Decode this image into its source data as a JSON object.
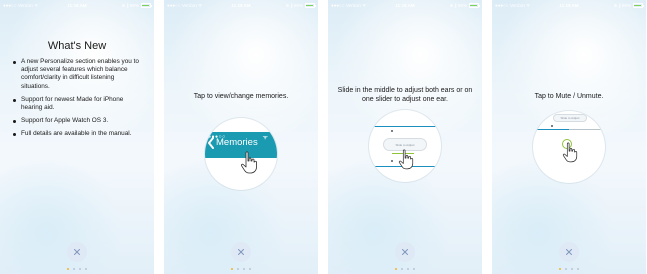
{
  "status_bar": {
    "carrier": "●●●○○ Verizon ᯤ",
    "time": "11:18 AM",
    "right_text": "⊕ ∦ 80%"
  },
  "screens": [
    {
      "title": "What's New",
      "bullets": [
        "A new Personalize section enables you to adjust several features which balance comfort/clarity in difficult listening situations.",
        "Support for newest Made for iPhone hearing aid.",
        "Support for Apple Watch OS 3.",
        "Full details are available in the manual."
      ]
    },
    {
      "instruction": "Tap to view/change memories.",
      "graphic": {
        "status_dots": "●●●○○",
        "wifi": "ᯤ",
        "back_label": "Memories"
      }
    },
    {
      "instruction": "Slide in the middle to adjust both ears or on one slider to adjust one ear.",
      "graphic": {
        "pill_label": "Slide to Adjust"
      }
    },
    {
      "instruction": "Tap to Mute / Unmute.",
      "graphic": {
        "pill_label": "Slide to Adjust"
      }
    }
  ],
  "page_indicator": {
    "count": 4,
    "active": 0
  },
  "icons": {
    "close": "close-icon",
    "hand": "hand-pointer-icon",
    "back_chevron": "chevron-left-icon",
    "battery": "battery-icon"
  },
  "colors": {
    "accent_teal": "#1b9bb1",
    "slider_blue": "#1b8fbf",
    "battery_green": "#7dd35a",
    "active_dot": "#f0b42a",
    "close_bg": "#dfe9f6"
  }
}
